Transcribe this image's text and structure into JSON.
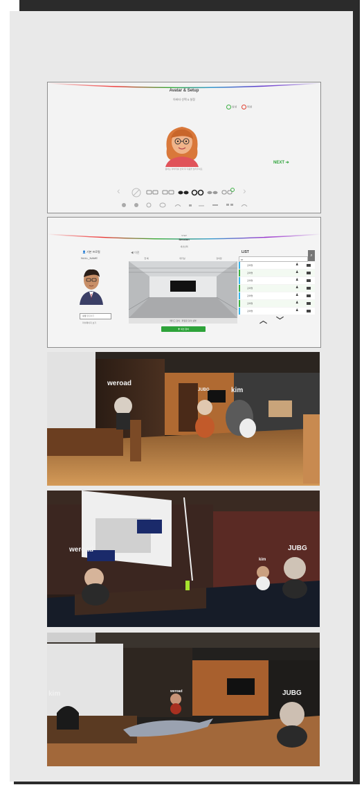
{
  "panel1": {
    "title": "Avatar & Setup",
    "subtitle": "아바타 선택 & 설정",
    "lang_option_1": "남성",
    "lang_option_2": "여성",
    "caption": "원하는 아바타를 선택 후 다음을 눌러주세요.",
    "next_label": "NEXT ➔"
  },
  "panel2": {
    "header_small": "STEP",
    "header_title": "Session",
    "header_sub": "세션선택",
    "profile_title": "기본 프로필",
    "profile_name": "NULL_NAME",
    "back_label": "◀ 이전",
    "tabs": [
      "전 체",
      "대기실",
      "강의장"
    ],
    "caption": "메타그 강의 · 파일럿 강의 설명",
    "enter_label": "✚ 세션 참여",
    "list_title": "LIST",
    "search_value": "67",
    "edit_button": "수정",
    "edit_label": "편집하기",
    "bottom_small": "마이페이지 보기",
    "items": [
      "강의명",
      "강의명",
      "강의명",
      "강의명",
      "강의명",
      "강의명",
      "강의명"
    ]
  },
  "scene1": {
    "labels": [
      "weroad",
      "kim",
      "JUBG"
    ]
  },
  "scene2": {
    "labels": [
      "weroad",
      "kim",
      "JUBG"
    ]
  },
  "scene3": {
    "labels": [
      "kim",
      "weroad",
      "JUBG"
    ]
  }
}
